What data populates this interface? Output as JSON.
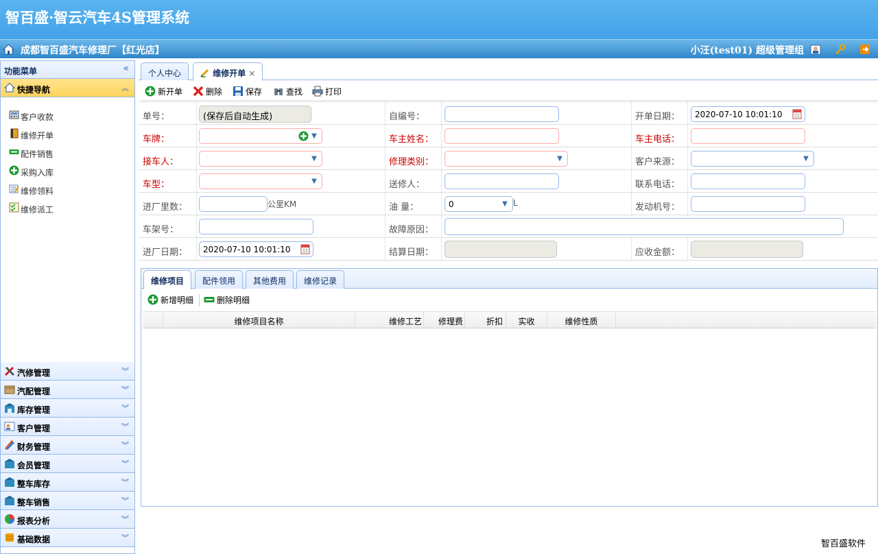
{
  "app": {
    "title": "智百盛·智云汽车4S管理系统",
    "company": "成都智百盛汽车修理厂【红光店】",
    "user": "小汪(test01)  超级管理组"
  },
  "sidebar": {
    "header": "功能菜单",
    "quick_nav": "快捷导航",
    "items": [
      {
        "label": "客户收款",
        "icon": "cash-register-icon"
      },
      {
        "label": "维修开单",
        "icon": "book-icon"
      },
      {
        "label": "配件销售",
        "icon": "minus-box-icon"
      },
      {
        "label": "采购入库",
        "icon": "plus-icon"
      },
      {
        "label": "维修领料",
        "icon": "note-icon"
      },
      {
        "label": "维修派工",
        "icon": "checklist-icon"
      }
    ],
    "sections": [
      {
        "label": "汽修管理",
        "icon": "tools-icon"
      },
      {
        "label": "汽配管理",
        "icon": "box-icon"
      },
      {
        "label": "库存管理",
        "icon": "warehouse-icon"
      },
      {
        "label": "客户管理",
        "icon": "contact-card-icon"
      },
      {
        "label": "财务管理",
        "icon": "pencil-money-icon"
      },
      {
        "label": "会员管理",
        "icon": "member-icon"
      },
      {
        "label": "整车库存",
        "icon": "car-stock-icon"
      },
      {
        "label": "整车销售",
        "icon": "car-sale-icon"
      },
      {
        "label": "报表分析",
        "icon": "pie-chart-icon"
      },
      {
        "label": "基础数据",
        "icon": "database-icon"
      }
    ]
  },
  "tabs": [
    {
      "label": "个人中心"
    },
    {
      "label": "维修开单",
      "close": "×"
    }
  ],
  "toolbar": {
    "new": "新开单",
    "delete": "删除",
    "save": "保存",
    "find": "查找",
    "print": "打印"
  },
  "form": {
    "order_no_label": "单号：",
    "order_no_value": "(保存后自动生成)",
    "self_no_label": "自编号：",
    "open_date_label": "开单日期：",
    "open_date_value": "2020-07-10 10:01:10",
    "plate_label": "车牌：",
    "owner_name_label": "车主姓名：",
    "owner_phone_label": "车主电话：",
    "receiver_label": "接车人：",
    "repair_type_label": "修理类别：",
    "source_label": "客户来源：",
    "model_label": "车型：",
    "sender_label": "送修人：",
    "contact_phone_label": "联系电话：",
    "mileage_label": "进厂里数：",
    "mileage_unit": "公里KM",
    "fuel_label": "油 量：",
    "fuel_value": "0",
    "fuel_unit": "L",
    "engine_label": "发动机号：",
    "vin_label": "车架号：",
    "fault_label": "故障原因：",
    "in_date_label": "进厂日期：",
    "in_date_value": "2020-07-10 10:01:10",
    "settle_date_label": "结算日期：",
    "receivable_label": "应收金额："
  },
  "subtabs": [
    "维修项目",
    "配件领用",
    "其他费用",
    "维修记录"
  ],
  "subtoolbar": {
    "add": "新增明细",
    "remove": "删除明细"
  },
  "grid_columns": [
    "维修项目名称",
    "维修工艺",
    "修理费",
    "折扣",
    "实收",
    "维修性质"
  ],
  "footer": "智百盛软件"
}
